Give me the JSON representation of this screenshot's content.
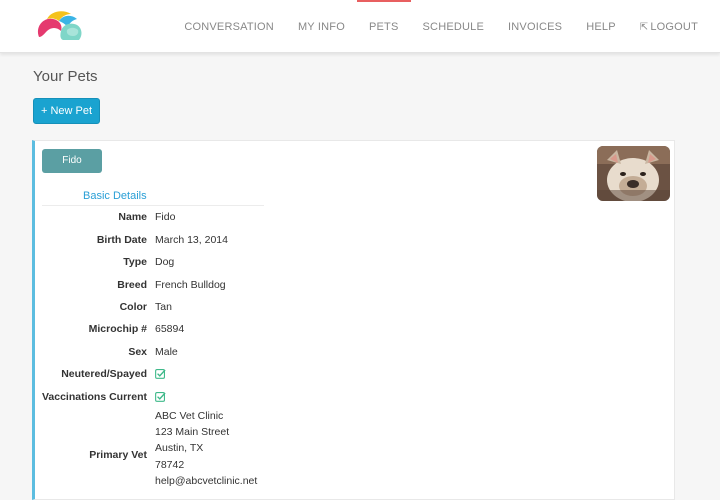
{
  "nav": {
    "items": [
      "CONVERSATION",
      "MY INFO",
      "PETS",
      "SCHEDULE",
      "INVOICES",
      "HELP"
    ],
    "active": "PETS",
    "logout_label": "LOGOUT",
    "accent_color": "#e85f60"
  },
  "page": {
    "title": "Your Pets",
    "new_pet_label": "+ New Pet"
  },
  "pet": {
    "name_button": "Fido",
    "section_title": "Basic Details",
    "details": [
      {
        "label": "Name",
        "value": "Fido"
      },
      {
        "label": "Birth Date",
        "value": "March 13, 2014"
      },
      {
        "label": "Type",
        "value": "Dog"
      },
      {
        "label": "Breed",
        "value": "French Bulldog"
      },
      {
        "label": "Color",
        "value": "Tan"
      },
      {
        "label": "Microchip #",
        "value": "65894"
      },
      {
        "label": "Sex",
        "value": "Male"
      },
      {
        "label": "Neutered/Spayed",
        "value": true
      },
      {
        "label": "Vaccinations Current",
        "value": true
      }
    ],
    "primary_vet": {
      "label": "Primary Vet",
      "lines": [
        "ABC Vet Clinic",
        "123 Main Street",
        "Austin, TX",
        "78742",
        "help@abcvetclinic.net"
      ]
    }
  },
  "colors": {
    "primary_button": "#1aa3d0",
    "pet_button": "#5b9fa3",
    "link": "#2a9fd6",
    "check": "#3fb98a",
    "card_accent": "#5cbde0"
  },
  "icons": {
    "logo": "brand-logo",
    "logout": "logout-icon",
    "checkbox": "checked-box-icon"
  }
}
